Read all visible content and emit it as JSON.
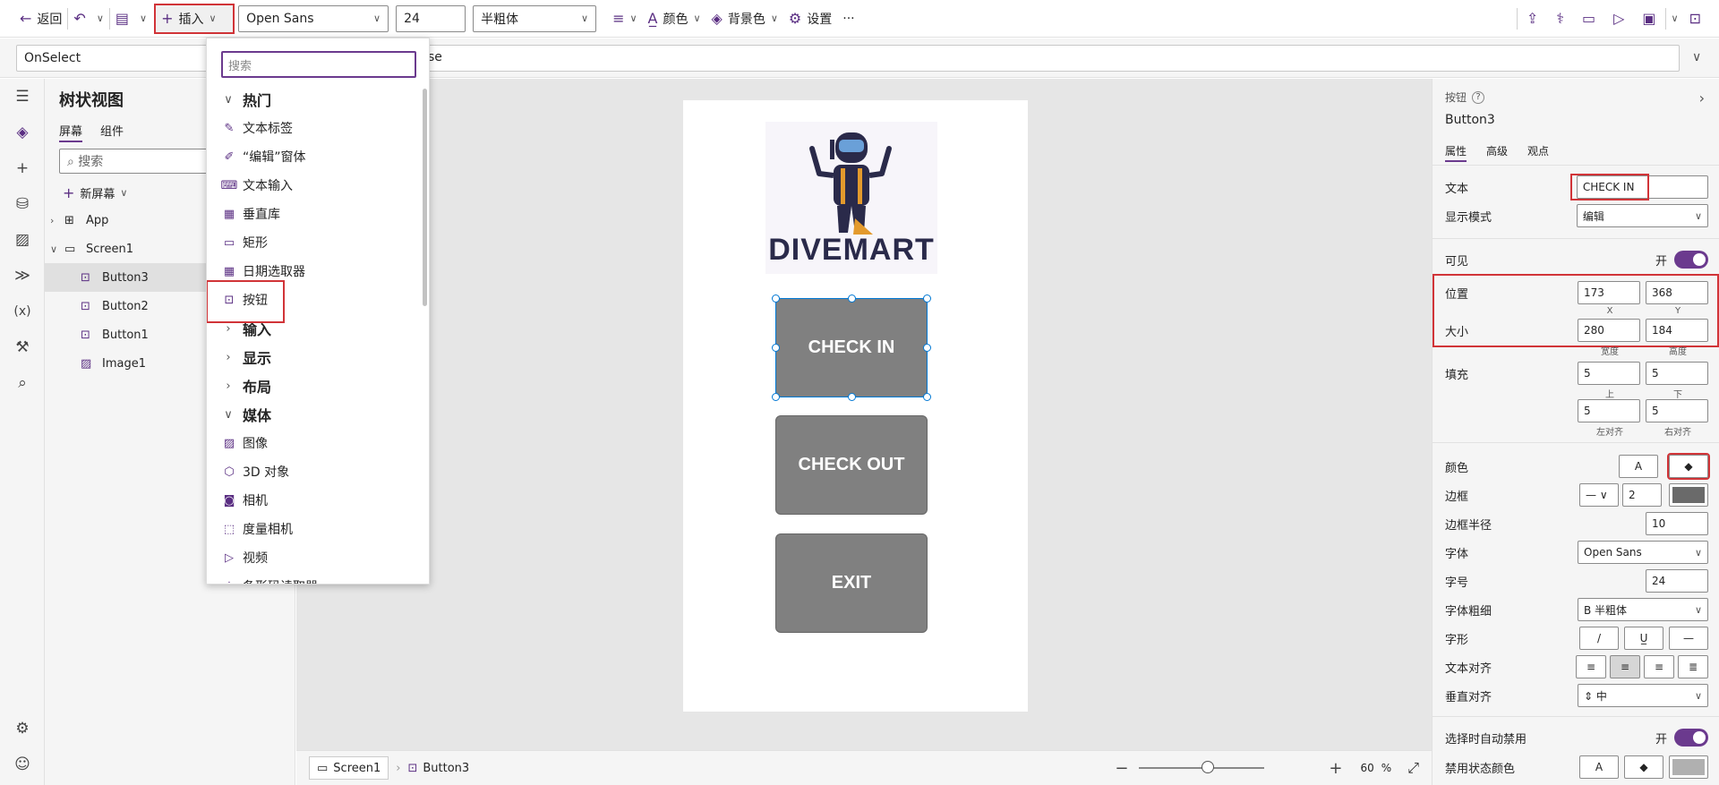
{
  "toolbar": {
    "back_label": "返回",
    "insert_label": "插入",
    "font_value": "Open Sans",
    "size_value": "24",
    "weight_value": "半粗体",
    "color_label": "颜色",
    "background_label": "背景色",
    "settings_label": "设置",
    "more_label": "···"
  },
  "formula": {
    "property": "OnSelect",
    "expression_fragment": "se"
  },
  "tree": {
    "title": "树状视图",
    "tab_screens": "屏幕",
    "tab_components": "组件",
    "search_placeholder": "搜索",
    "new_screen": "新屏幕",
    "items": [
      "App",
      "Screen1",
      "Button3",
      "Button2",
      "Button1",
      "Image1"
    ]
  },
  "insert_menu": {
    "search_placeholder": "搜索",
    "items": [
      {
        "label": "热门",
        "kind": "category",
        "icon": "chevron-down-icon"
      },
      {
        "label": "文本标签",
        "kind": "item",
        "icon": "label-icon"
      },
      {
        "label": "“编辑”窗体",
        "kind": "item",
        "icon": "edit-form-icon"
      },
      {
        "label": "文本输入",
        "kind": "item",
        "icon": "text-input-icon"
      },
      {
        "label": "垂直库",
        "kind": "item",
        "icon": "gallery-icon"
      },
      {
        "label": "矩形",
        "kind": "item",
        "icon": "rectangle-icon"
      },
      {
        "label": "日期选取器",
        "kind": "item",
        "icon": "calendar-icon"
      },
      {
        "label": "按钮",
        "kind": "item",
        "icon": "button-icon"
      },
      {
        "label": "输入",
        "kind": "category",
        "icon": "chevron-right-icon"
      },
      {
        "label": "显示",
        "kind": "category",
        "icon": "chevron-right-icon"
      },
      {
        "label": "布局",
        "kind": "category",
        "icon": "chevron-right-icon"
      },
      {
        "label": "媒体",
        "kind": "category",
        "icon": "chevron-down-icon"
      },
      {
        "label": "图像",
        "kind": "item",
        "icon": "image-icon"
      },
      {
        "label": "3D 对象",
        "kind": "item",
        "icon": "cube-icon"
      },
      {
        "label": "相机",
        "kind": "item",
        "icon": "camera-icon"
      },
      {
        "label": "度量相机",
        "kind": "item",
        "icon": "measure-camera-icon"
      },
      {
        "label": "视频",
        "kind": "item",
        "icon": "video-icon"
      },
      {
        "label": "条形码读取器",
        "kind": "item",
        "icon": "barcode-icon"
      }
    ]
  },
  "app": {
    "logo_text": "DIVEMART",
    "buttons": [
      "CHECK IN",
      "CHECK OUT",
      "EXIT"
    ]
  },
  "status": {
    "screen": "Screen1",
    "control": "Button3",
    "zoom": "60",
    "zoom_unit": "%"
  },
  "props": {
    "type_label": "按钮",
    "control_name": "Button3",
    "tabs": [
      "属性",
      "高级",
      "观点"
    ],
    "text_label": "文本",
    "text_value": "CHECK IN",
    "display_mode_label": "显示模式",
    "display_mode_value": "编辑",
    "visible_label": "可见",
    "on_label": "开",
    "position_label": "位置",
    "x_value": "173",
    "y_value": "368",
    "x_caption": "X",
    "y_caption": "Y",
    "size_label": "大小",
    "width_value": "280",
    "height_value": "184",
    "width_caption": "宽度",
    "height_caption": "高度",
    "padding_label": "填充",
    "pad_top": "5",
    "pad_bottom": "5",
    "pad_left": "5",
    "pad_right": "5",
    "top_caption": "上",
    "bottom_caption": "下",
    "left_caption": "左对齐",
    "right_caption": "右对齐",
    "color_label": "颜色",
    "border_label": "边框",
    "border_value": "2",
    "radius_label": "边框半径",
    "radius_value": "10",
    "font_label": "字体",
    "font_value": "Open Sans",
    "size_label2": "字号",
    "size_value": "24",
    "weight_label": "字体粗细",
    "weight_value": "B 半粗体",
    "style_label": "字形",
    "align_label": "文本对齐",
    "valign_label": "垂直对齐",
    "valign_value": "中",
    "auto_disable_label": "选择时自动禁用",
    "disabled_color_label": "禁用状态颜色"
  },
  "colors": {
    "accent": "#6b3a8e",
    "button_fill": "#808080",
    "highlight": "#d13438",
    "selection": "#0078d4"
  }
}
